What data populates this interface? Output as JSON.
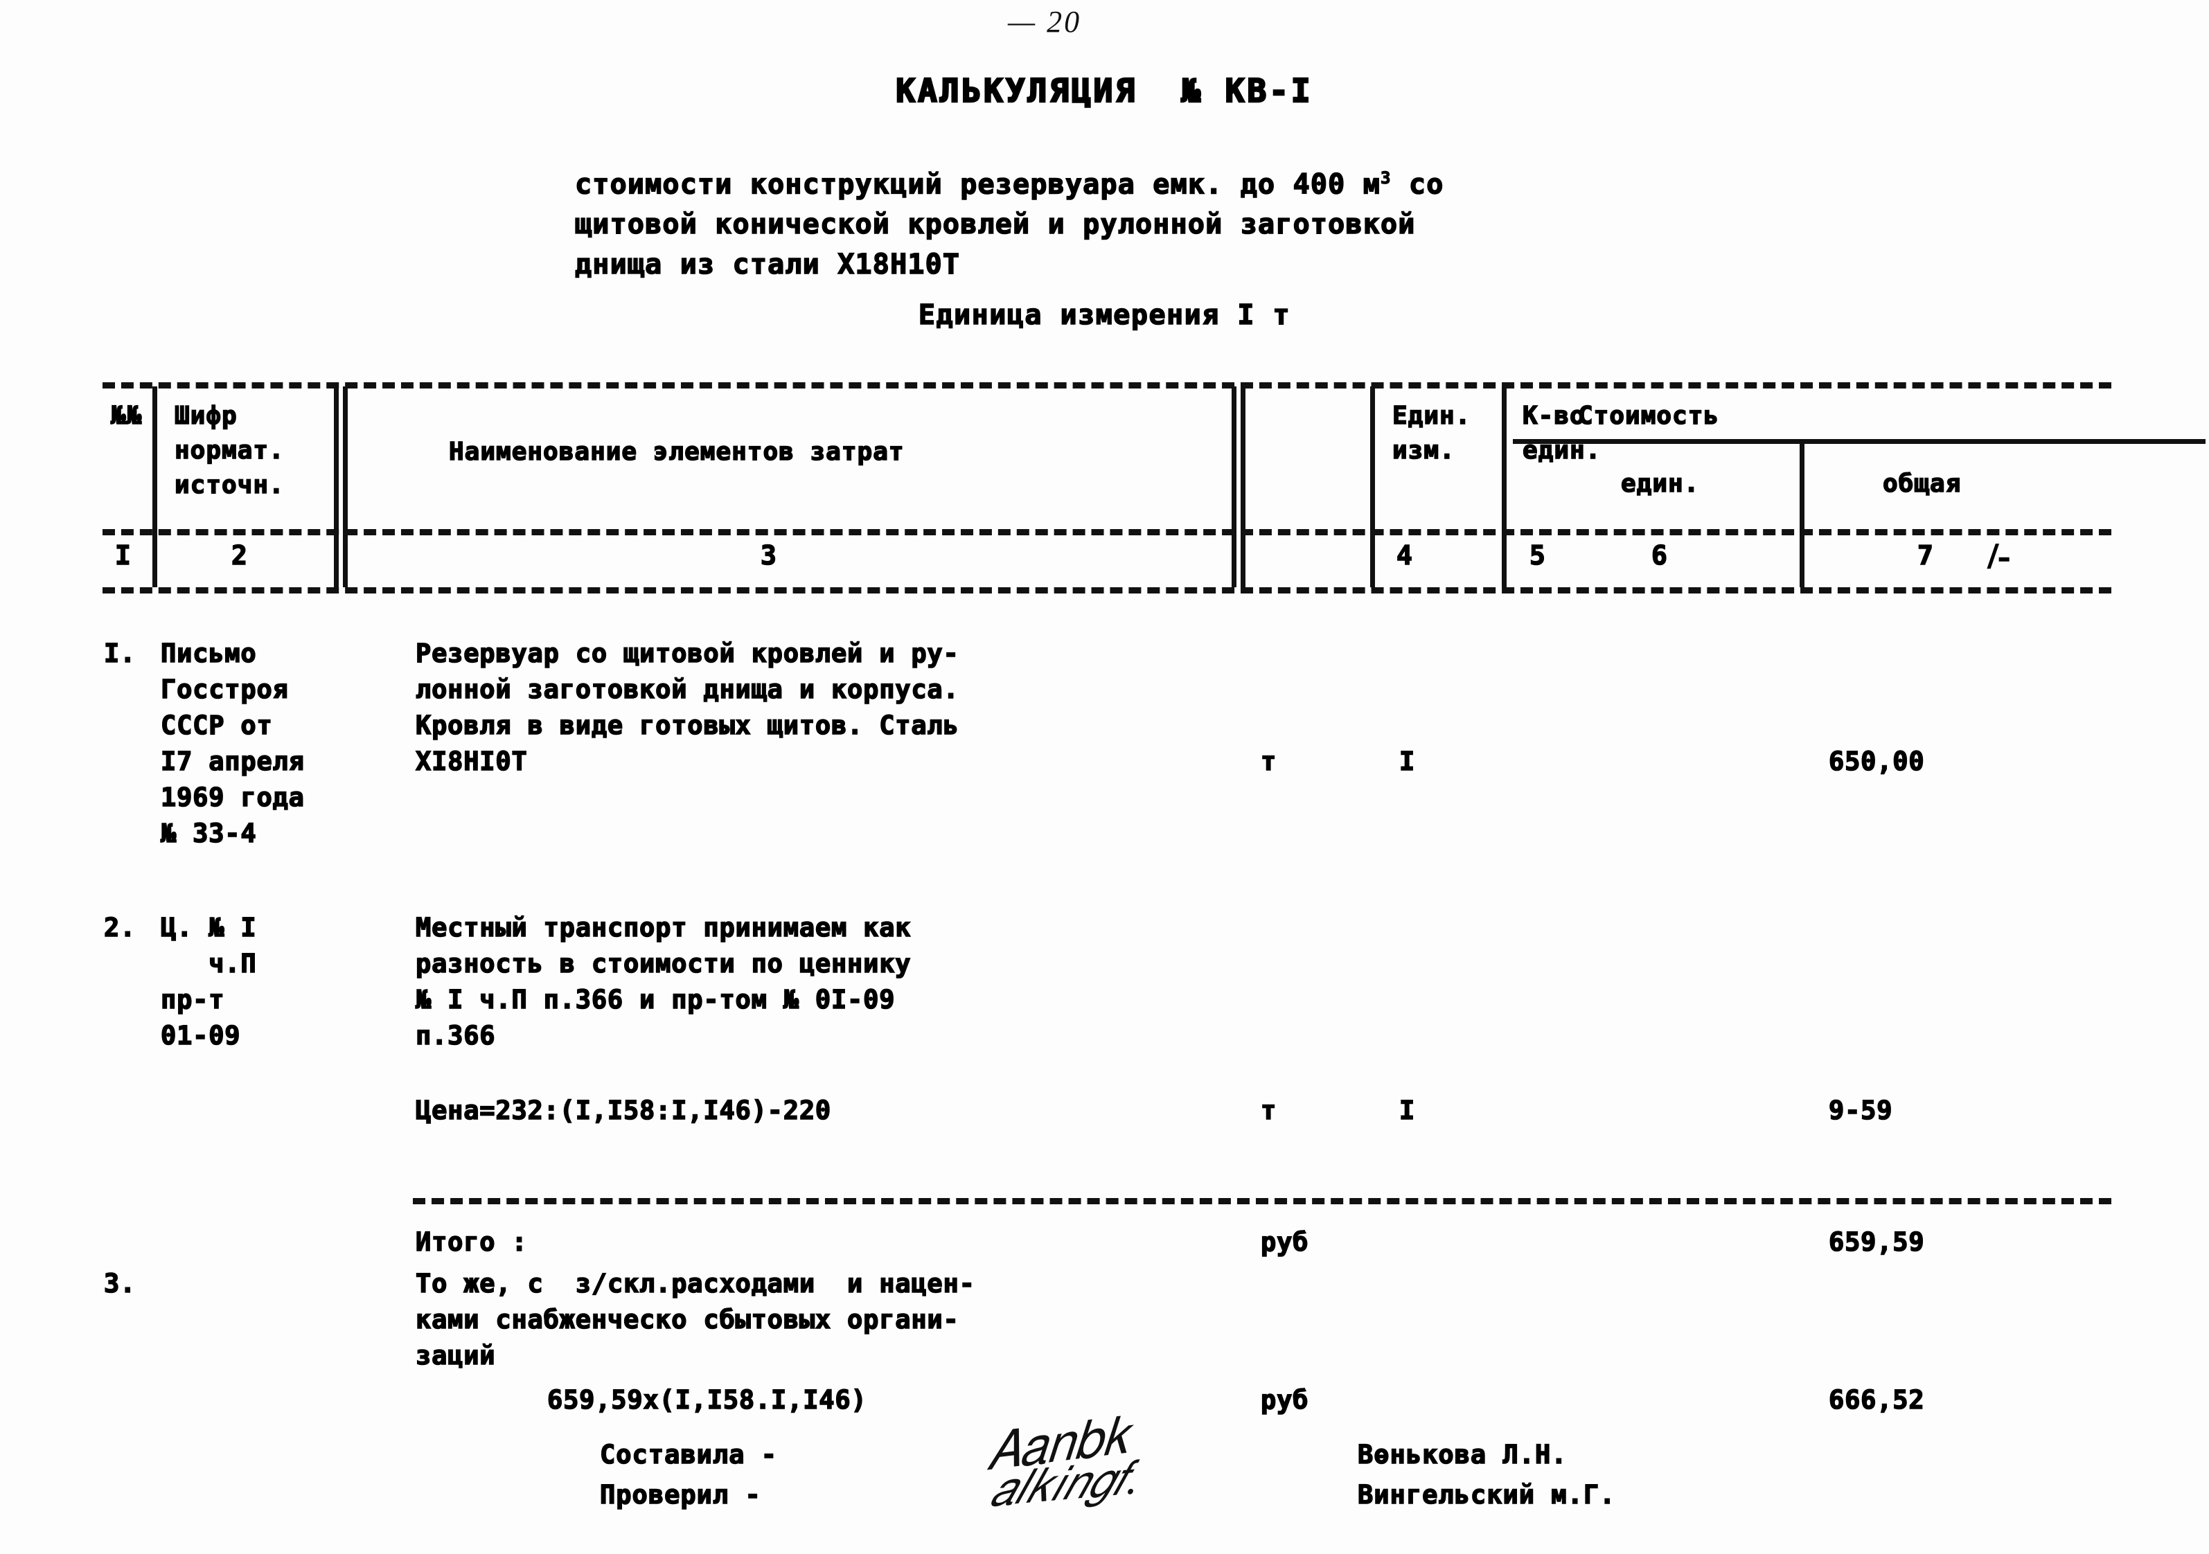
{
  "page": {
    "page_number_mark": "— 20"
  },
  "header": {
    "title": "КАЛЬКУЛЯЦИЯ  № КВ-I",
    "subtitle_lines": [
      "стоимости конструкций резервуара емк. до 400 м",
      "щитовой конической кровлей и рулонной заготовкой",
      "днища из стали Х18Н10Т"
    ],
    "subtitle_superscript": "3",
    "subtitle_tail": " со",
    "unit_line": "Единица измерения I т"
  },
  "table": {
    "columns": [
      {
        "num": "I",
        "label": "№№"
      },
      {
        "num": "2",
        "label": "Шифр\nнормат.\nисточн."
      },
      {
        "num": "3",
        "label": "Наименование элементов затрат"
      },
      {
        "num": "4",
        "label": "Един.\nизм."
      },
      {
        "num": "5",
        "label": "К-во\nедин."
      },
      {
        "num": "6",
        "label": "един."
      },
      {
        "num": "7",
        "label": "общая"
      }
    ],
    "group_header": "Стоимость",
    "edge_mark": "/-",
    "rows": [
      {
        "num": "I.",
        "code": "Письмо\nГосстроя\nСССР от\nI7 апреля\n1969 года\n№ 33-4",
        "desc": "Резервуар со щитовой кровлей и ру-\nлонной заготовкой днища и корпуса.\nКровля в виде готовых щитов. Сталь\nХI8НI0Т",
        "unit": "т",
        "qty": "I",
        "price": "",
        "total": "650,00"
      },
      {
        "num": "2.",
        "code": "Ц. № I\n   ч.П\nпр-т\n01-09",
        "desc": "Местный транспорт принимаем как\nразность в стоимости по ценнику\n№ I ч.П п.366 и пр-том № 0I-09\nп.366",
        "unit": "",
        "qty": "",
        "price": "",
        "total": ""
      },
      {
        "num": "",
        "code": "",
        "desc": "Цена=232:(I,I58:I,I46)-220",
        "unit": "т",
        "qty": "I",
        "price": "",
        "total": "9-59"
      }
    ],
    "subtotal": {
      "label": "Итого :",
      "unit": "руб",
      "total": "659,59"
    },
    "final_row": {
      "num": "3.",
      "desc": "То же, с  з/скл.расходами  и нацен-\nками снабженческо сбытовых органи-\nзаций",
      "formula": "659,59х(I,I58.I,I46)",
      "unit": "руб",
      "total": "666,52"
    }
  },
  "signatures": {
    "labels": [
      "Составила -",
      "Проверил -"
    ],
    "names": [
      "Вөнькова Л.Н.",
      "Вингельский м.Г."
    ]
  }
}
